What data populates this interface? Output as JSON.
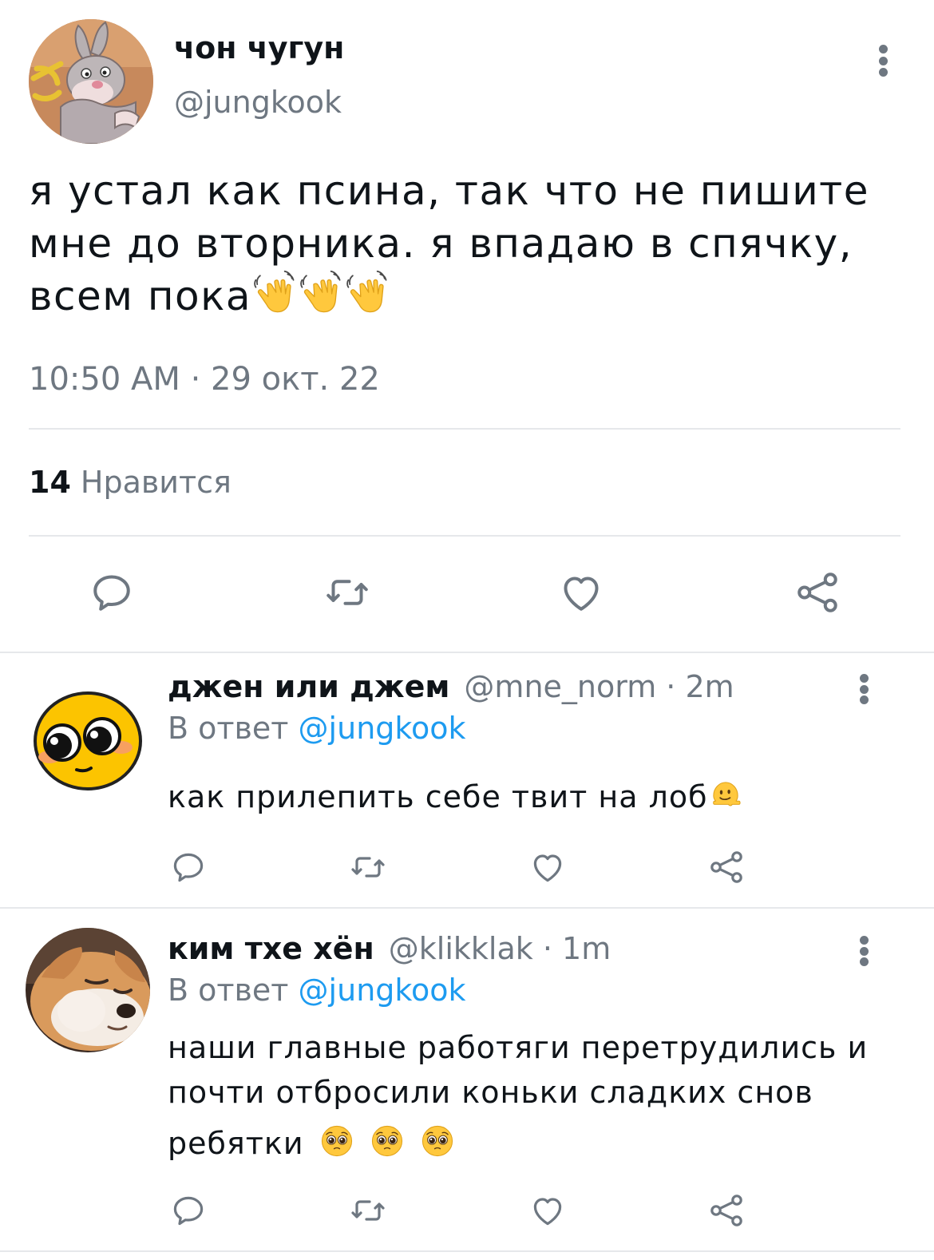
{
  "tweet": {
    "author_name": "чон чугун",
    "author_handle": "@jungkook",
    "text": "я устал как псина, так что не пишите мне до вторника. я впадаю в спячку, всем пока",
    "emoji": [
      "waving-hand-emoji",
      "waving-hand-emoji",
      "waving-hand-emoji"
    ],
    "timestamp": "10:50 AM · 29 окт. 22",
    "likes_count": "14",
    "likes_label": "Нравится"
  },
  "replies": [
    {
      "author_name": "джен или джем",
      "meta": "@mne_norm · 2m",
      "reply_prefix": "В ответ",
      "reply_mention": "@jungkook",
      "text": "как прилепить себе твит на лоб",
      "emoji": [
        "melting-face-emoji"
      ]
    },
    {
      "author_name": "ким тхе хён",
      "meta": "@klikklak · 1m",
      "reply_prefix": "В ответ",
      "reply_mention": "@jungkook",
      "text_line1": "наши главные работяги перетрудились и",
      "text_line2": "почти отбросили коньки сладких снов",
      "text_line3": "ребятки",
      "emoji": [
        "pleading-face-emoji",
        "pleading-face-emoji",
        "pleading-face-emoji"
      ]
    }
  ],
  "colors": {
    "text": "#0f1419",
    "secondary": "#6e7781",
    "link": "#1d9bf0",
    "divider": "#e6e8eb",
    "icon": "#6e7781"
  }
}
